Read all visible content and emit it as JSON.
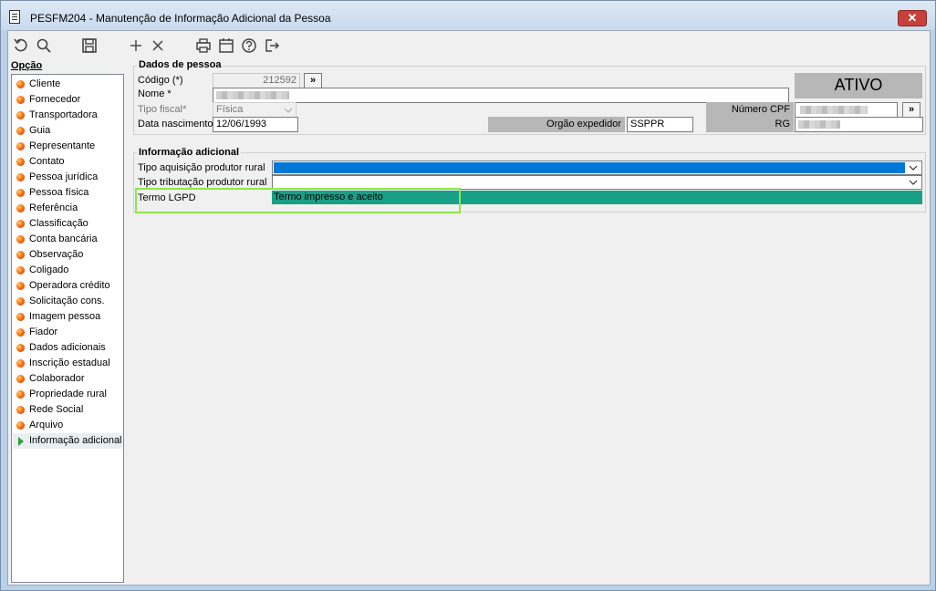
{
  "window": {
    "title": "PESFM204 - Manutenção de Informação Adicional da Pessoa",
    "close_label": "✕"
  },
  "toolbar": {
    "icons": [
      "undo-icon",
      "search-icon",
      "save-icon",
      "add-icon",
      "cancel-icon",
      "print-icon",
      "calendar-icon",
      "help-icon",
      "exit-icon"
    ]
  },
  "sidebar": {
    "title": "Opção",
    "items": [
      {
        "label": "Cliente"
      },
      {
        "label": "Fornecedor"
      },
      {
        "label": "Transportadora"
      },
      {
        "label": "Guia"
      },
      {
        "label": "Representante"
      },
      {
        "label": "Contato"
      },
      {
        "label": "Pessoa jurídica"
      },
      {
        "label": "Pessoa física"
      },
      {
        "label": "Referência"
      },
      {
        "label": "Classificação"
      },
      {
        "label": "Conta bancária"
      },
      {
        "label": "Observação"
      },
      {
        "label": "Coligado"
      },
      {
        "label": "Operadora crédito"
      },
      {
        "label": "Solicitação cons."
      },
      {
        "label": "Imagem pessoa"
      },
      {
        "label": "Fiador"
      },
      {
        "label": "Dados adicionais"
      },
      {
        "label": "Inscrição estadual"
      },
      {
        "label": "Colaborador"
      },
      {
        "label": "Propriedade rural"
      },
      {
        "label": "Rede Social"
      },
      {
        "label": "Arquivo"
      },
      {
        "label": "Informação adicional"
      }
    ],
    "active_label": "Informação adicional"
  },
  "dados": {
    "title": "Dados de pessoa",
    "codigo_label": "Código (*)",
    "codigo_value": "212592",
    "nome_label": "Nome *",
    "tipo_fiscal_label": "Tipo fiscal*",
    "tipo_fiscal_value": "Física",
    "data_nasc_label": "Data nascimento",
    "data_nasc_value": "12/06/1993",
    "orgao_label": "Orgão expedidor",
    "orgao_value": "SSPPR",
    "cpf_label": "Número CPF",
    "rg_label": "RG",
    "status": "ATIVO",
    "arrow_label": "»"
  },
  "info": {
    "title": "Informação adicional",
    "aquisicao_label": "Tipo aquisição produtor rural",
    "tributacao_label": "Tipo tributação produtor rural",
    "lgpd_label": "Termo LGPD",
    "lgpd_value": "Termo impresso e aceito"
  },
  "colors": {
    "selected_blue": "#0078d7",
    "teal": "#18a086",
    "highlight": "#8ee64a"
  }
}
